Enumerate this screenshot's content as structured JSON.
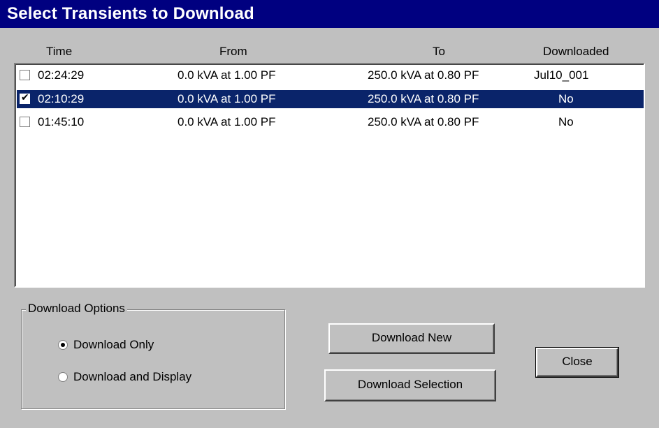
{
  "window": {
    "title": "Select Transients to Download"
  },
  "columns": {
    "time": "Time",
    "from": "From",
    "to": "To",
    "downloaded": "Downloaded"
  },
  "rows": [
    {
      "checked": false,
      "selected": false,
      "time": "02:24:29",
      "from": "0.0 kVA at 1.00 PF",
      "to": "250.0 kVA at 0.80 PF",
      "downloaded": "Jul10_001"
    },
    {
      "checked": true,
      "selected": true,
      "time": "02:10:29",
      "from": "0.0 kVA at 1.00 PF",
      "to": "250.0 kVA at 0.80 PF",
      "downloaded": "No"
    },
    {
      "checked": false,
      "selected": false,
      "time": "01:45:10",
      "from": "0.0 kVA at 1.00 PF",
      "to": "250.0 kVA at 0.80 PF",
      "downloaded": "No"
    }
  ],
  "options": {
    "legend": "Download Options",
    "radio_download_only": "Download Only",
    "radio_download_display": "Download and Display",
    "selected": "download_only"
  },
  "buttons": {
    "download_new": "Download New",
    "download_selection": "Download Selection",
    "close": "Close"
  },
  "colors": {
    "titlebar": "#000080",
    "selection": "#0a246a",
    "face": "#c0c0c0"
  }
}
